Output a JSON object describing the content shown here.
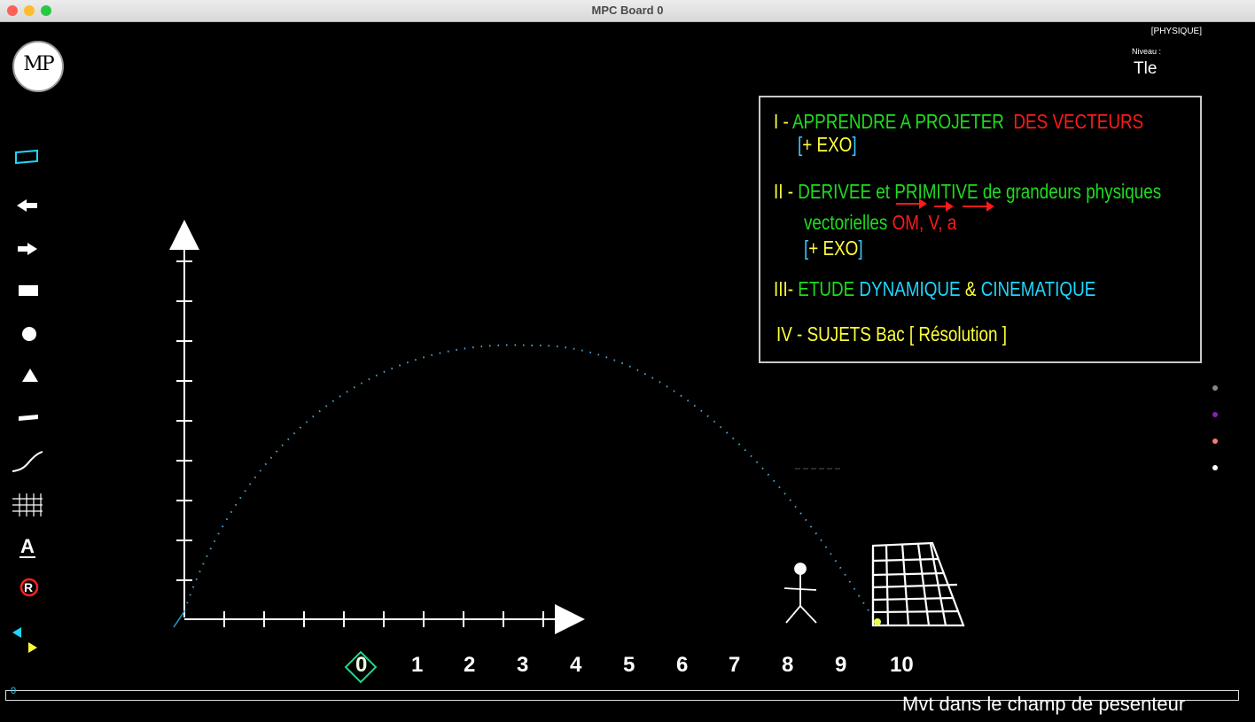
{
  "window": {
    "title": "MPC Board 0"
  },
  "header": {
    "subject": "[PHYSIQUE]",
    "niveau_label": "Niveau :",
    "niveau_value": "Tle"
  },
  "logo": {
    "text": "MP"
  },
  "toolbar": {
    "tools": [
      "rectangle-outline-tool-icon",
      "arrow-left-icon",
      "arrow-right-icon",
      "filled-rectangle-tool-icon",
      "circle-tool-icon",
      "triangle-tool-icon",
      "line-tool-icon",
      "curve-tool-icon",
      "grid-tool-icon",
      "text-tool-icon",
      "reset-tool-icon",
      "color-swap-icon"
    ]
  },
  "menu": {
    "item1": {
      "num": "I -",
      "green": "APPRENDRE  A  PROJETER",
      "red": "DES VECTEURS",
      "exo_plus": "+",
      "exo_label": "EXO"
    },
    "item2": {
      "num": "II -",
      "green1": "DERIVEE et PRIMITIVE",
      "green2": "de grandeurs physiques",
      "green3": "vectorielles",
      "red": "OM, V,  a",
      "exo_plus": "+",
      "exo_label": "EXO"
    },
    "item3": {
      "num": "III-",
      "green": "ETUDE",
      "cyan1": "DYNAMIQUE",
      "amp": "&",
      "cyan2": "CINEMATIQUE"
    },
    "item4": {
      "label": "IV - SUJETS Bac  [ Résolution ]"
    }
  },
  "axis_numbers": [
    "0",
    "1",
    "2",
    "3",
    "4",
    "5",
    "6",
    "7",
    "8",
    "9",
    "10"
  ],
  "status": {
    "value": "0",
    "caption": "Mvt dans le champ de pesenteur"
  },
  "palette": {
    "colors": [
      "#888888",
      "#8a1fb0",
      "#ff7a6a",
      "#ffffff"
    ]
  },
  "colors": {
    "axis": "#ffffff",
    "trajectory": "#2a9ad0",
    "menu_border": "#c8c8c8"
  }
}
